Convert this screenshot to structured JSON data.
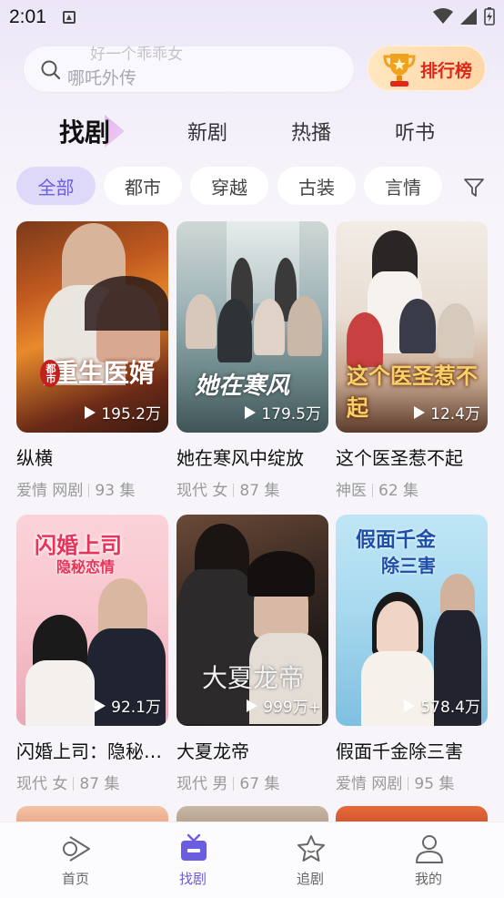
{
  "status_bar": {
    "time": "2:01"
  },
  "search": {
    "placeholder_top": "好一个乖乖女",
    "placeholder": "哪吒外传"
  },
  "ranking_button": {
    "label": "排行榜"
  },
  "tabs": [
    {
      "label": "找剧",
      "active": true
    },
    {
      "label": "新剧"
    },
    {
      "label": "热播"
    },
    {
      "label": "听书"
    }
  ],
  "chips": [
    {
      "label": "全部",
      "active": true
    },
    {
      "label": "都市"
    },
    {
      "label": "穿越"
    },
    {
      "label": "古装"
    },
    {
      "label": "言情"
    }
  ],
  "cards": [
    {
      "title": "纵横",
      "tags": "爱情 网剧",
      "episodes": "93 集",
      "views": "195.2万",
      "poster_text": "重生医婿",
      "poster_badge": "都市"
    },
    {
      "title": "她在寒风中绽放",
      "tags": "现代 女",
      "episodes": "87 集",
      "views": "179.5万",
      "poster_text": "她在寒风"
    },
    {
      "title": "这个医圣惹不起",
      "tags": "神医",
      "episodes": "62 集",
      "views": "12.4万",
      "poster_text": "这个医圣惹不起"
    },
    {
      "title": "闪婚上司：隐秘恋情",
      "tags": "现代 女",
      "episodes": "87 集",
      "views": "92.1万",
      "poster_text": "闪婚上司",
      "poster_sub": "隐秘恋情"
    },
    {
      "title": "大夏龙帝",
      "tags": "现代 男",
      "episodes": "67 集",
      "views": "999万+",
      "poster_text": "大夏龙帝"
    },
    {
      "title": "假面千金除三害",
      "tags": "爱情 网剧",
      "episodes": "95 集",
      "views": "578.4万",
      "poster_text": "假面千金",
      "poster_sub": "除三害"
    }
  ],
  "bottom_nav": [
    {
      "label": "首页"
    },
    {
      "label": "找剧",
      "active": true
    },
    {
      "label": "追剧"
    },
    {
      "label": "我的"
    }
  ],
  "colors": {
    "accent": "#6b5de0",
    "rank_text": "#e2261a"
  }
}
